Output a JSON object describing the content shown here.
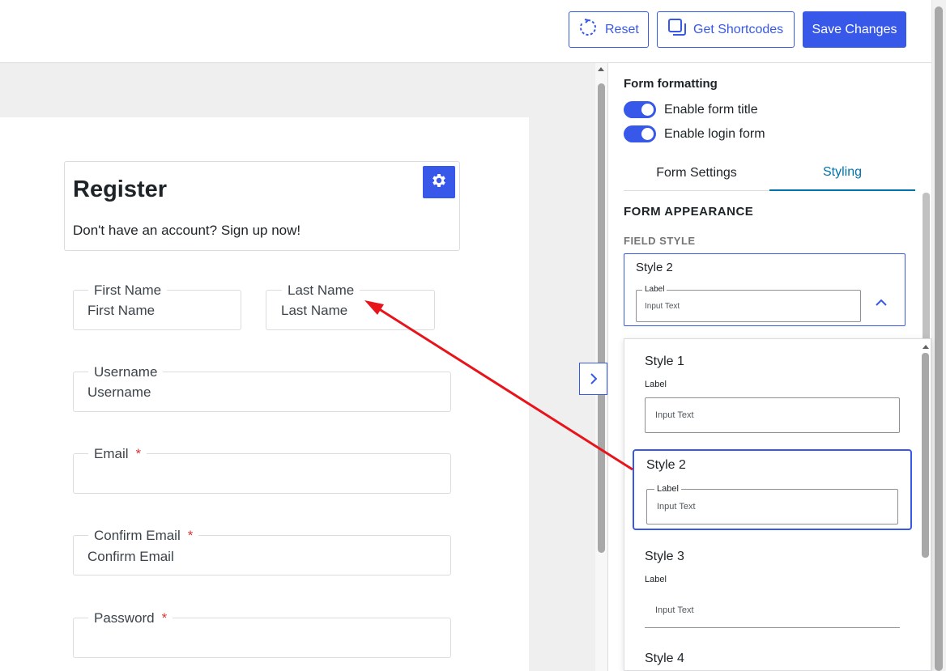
{
  "toolbar": {
    "reset_label": "Reset",
    "shortcodes_label": "Get Shortcodes",
    "save_label": "Save Changes"
  },
  "form": {
    "title": "Register",
    "description": "Don't have an account? Sign up now!",
    "fields": {
      "first_name": {
        "label": "First Name",
        "placeholder": "First Name"
      },
      "last_name": {
        "label": "Last Name",
        "placeholder": "Last Name"
      },
      "username": {
        "label": "Username",
        "placeholder": "Username"
      },
      "email": {
        "label": "Email",
        "required": "*"
      },
      "confirm_email": {
        "label": "Confirm Email",
        "required": "*",
        "placeholder": "Confirm Email"
      },
      "password": {
        "label": "Password",
        "required": "*"
      }
    }
  },
  "panel": {
    "section_title": "Form formatting",
    "toggles": [
      {
        "label": "Enable form title",
        "on": true
      },
      {
        "label": "Enable login form",
        "on": true
      }
    ],
    "tabs": [
      {
        "label": "Form Settings",
        "active": false
      },
      {
        "label": "Styling",
        "active": true
      }
    ],
    "appearance_heading": "FORM APPEARANCE",
    "field_style_heading": "FIELD STYLE",
    "selected_style": {
      "name": "Style 2",
      "preview_label": "Label",
      "preview_input": "Input Text"
    },
    "style_options": [
      {
        "name": "Style 1",
        "label": "Label",
        "input": "Input Text"
      },
      {
        "name": "Style 2",
        "label": "Label",
        "input": "Input Text",
        "selected": true
      },
      {
        "name": "Style 3",
        "label": "Label",
        "input": "Input Text"
      },
      {
        "name": "Style 4"
      }
    ]
  },
  "colors": {
    "accent": "#3858e9",
    "tab_active": "#0073aa",
    "required": "#d63638",
    "annotation_arrow": "#e8141b"
  },
  "icons": [
    "reset-icon",
    "shortcodes-icon",
    "gear-icon",
    "chevron-right-icon",
    "chevron-up-icon"
  ]
}
